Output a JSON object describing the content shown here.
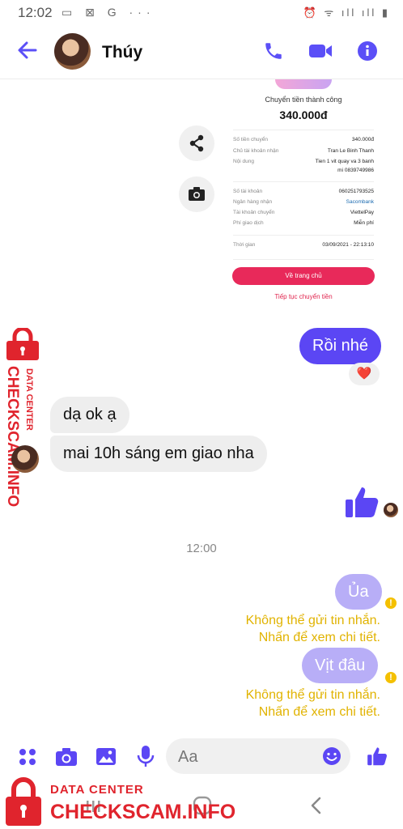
{
  "statusbar": {
    "time": "12:02",
    "app_icons": "▭ ⊠ G ···",
    "right_icons": "⏰ ᯤ ıll ıll ▮"
  },
  "header": {
    "name": "Thúy"
  },
  "receipt": {
    "status": "Chuyển tiền thành công",
    "amount": "340.000đ",
    "rows1": [
      {
        "label": "Số tiền chuyển",
        "value": "340.000đ"
      },
      {
        "label": "Chủ tài khoản nhận",
        "value": "Tran Le Binh Thanh"
      },
      {
        "label": "Nội dung",
        "value": "Tien 1 vit quay va 3 banh"
      },
      {
        "label": "",
        "value": "mi 0839749986"
      }
    ],
    "rows2": [
      {
        "label": "Số tài khoản",
        "value": "060251793525"
      },
      {
        "label": "Ngân hàng nhận",
        "value": "Sacombank"
      },
      {
        "label": "Tài khoản chuyển",
        "value": "ViettelPay"
      },
      {
        "label": "Phí giao dịch",
        "value": "Miễn phí"
      }
    ],
    "time_label": "Thời gian",
    "time_value": "03/09/2021 - 22:13:10",
    "home_button": "Về trang chủ",
    "continue_link": "Tiếp tục chuyển tiền"
  },
  "messages": {
    "out1": "Rồi nhé",
    "reaction": "❤️",
    "in1": "dạ ok ạ",
    "in2": "mai 10h sáng em giao nha",
    "timestamp": "12:00",
    "out2": "Ủa",
    "out3": "Vịt đâu",
    "error_line1": "Không thể gửi tin nhắn.",
    "error_line2": "Nhấn để xem chi tiết.",
    "error_icon": "!"
  },
  "composer": {
    "placeholder": "Aa"
  },
  "watermark": {
    "top_label": "DATA CENTER",
    "brand": "CHECKSCAM.INFO",
    "side_label": "DATA CENTER",
    "side_brand": "CHECKSCAM.INFO"
  },
  "colors": {
    "accent": "#5b46f4",
    "error": "#e1b300",
    "watermark": "#e0242d",
    "receipt_button": "#e8295a"
  }
}
